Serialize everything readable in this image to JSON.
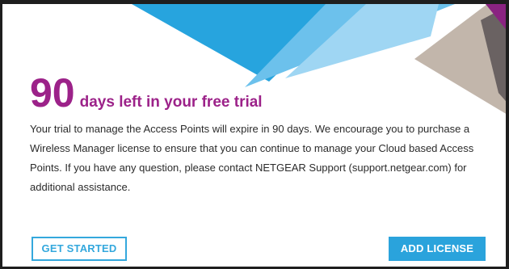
{
  "trial": {
    "days_number": "90",
    "days_text": "days left in your free trial",
    "message": "Your trial to manage the Access Points will expire in 90 days. We encourage you to purchase a Wireless Manager license to ensure that you can continue to manage your Cloud based Access Points. If you have any question, please contact NETGEAR Support (support.netgear.com) for additional assistance."
  },
  "buttons": {
    "get_started": "GET STARTED",
    "add_license": "ADD LICENSE"
  },
  "colors": {
    "accent_purple": "#9c2289",
    "accent_blue": "#2aa3dc",
    "text": "#2b2b2b"
  }
}
